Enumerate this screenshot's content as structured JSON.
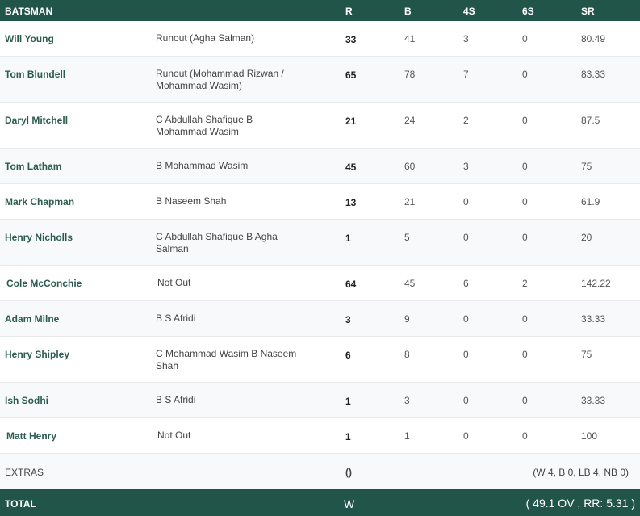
{
  "header": {
    "batsman": "BATSMAN",
    "r": "R",
    "b": "B",
    "fours": "4S",
    "sixes": "6S",
    "sr": "SR"
  },
  "batsmen": [
    {
      "name": "Will Young",
      "dismissal": "Runout (Agha Salman)",
      "r": "33",
      "b": "41",
      "fours": "3",
      "sixes": "0",
      "sr": "80.49"
    },
    {
      "name": "Tom Blundell",
      "dismissal": "Runout (Mohammad Rizwan / Mohammad Wasim)",
      "r": "65",
      "b": "78",
      "fours": "7",
      "sixes": "0",
      "sr": "83.33"
    },
    {
      "name": "Daryl Mitchell",
      "dismissal": "C Abdullah Shafique B Mohammad Wasim",
      "r": "21",
      "b": "24",
      "fours": "2",
      "sixes": "0",
      "sr": "87.5"
    },
    {
      "name": "Tom Latham",
      "dismissal": "B Mohammad Wasim",
      "r": "45",
      "b": "60",
      "fours": "3",
      "sixes": "0",
      "sr": "75"
    },
    {
      "name": "Mark Chapman",
      "dismissal": "B Naseem Shah",
      "r": "13",
      "b": "21",
      "fours": "0",
      "sixes": "0",
      "sr": "61.9"
    },
    {
      "name": "Henry Nicholls",
      "dismissal": "C Abdullah Shafique B Agha Salman",
      "r": "1",
      "b": "5",
      "fours": "0",
      "sixes": "0",
      "sr": "20"
    },
    {
      "name": "Cole McConchie",
      "dismissal": "Not Out",
      "r": "64",
      "b": "45",
      "fours": "6",
      "sixes": "2",
      "sr": "142.22"
    },
    {
      "name": "Adam Milne",
      "dismissal": "B S Afridi",
      "r": "3",
      "b": "9",
      "fours": "0",
      "sixes": "0",
      "sr": "33.33"
    },
    {
      "name": "Henry Shipley",
      "dismissal": "C Mohammad Wasim B Naseem Shah",
      "r": "6",
      "b": "8",
      "fours": "0",
      "sixes": "0",
      "sr": "75"
    },
    {
      "name": "Ish Sodhi",
      "dismissal": "B S Afridi",
      "r": "1",
      "b": "3",
      "fours": "0",
      "sixes": "0",
      "sr": "33.33"
    },
    {
      "name": "Matt Henry",
      "dismissal": "Not Out",
      "r": "1",
      "b": "1",
      "fours": "0",
      "sixes": "0",
      "sr": "100"
    }
  ],
  "extras": {
    "label": "EXTRAS",
    "value": "()",
    "detail": "(W 4, B 0, LB 4, NB 0)"
  },
  "total": {
    "label": "TOTAL",
    "value": "W",
    "overs": "( 49.1 OV , RR: 5.31 )"
  }
}
